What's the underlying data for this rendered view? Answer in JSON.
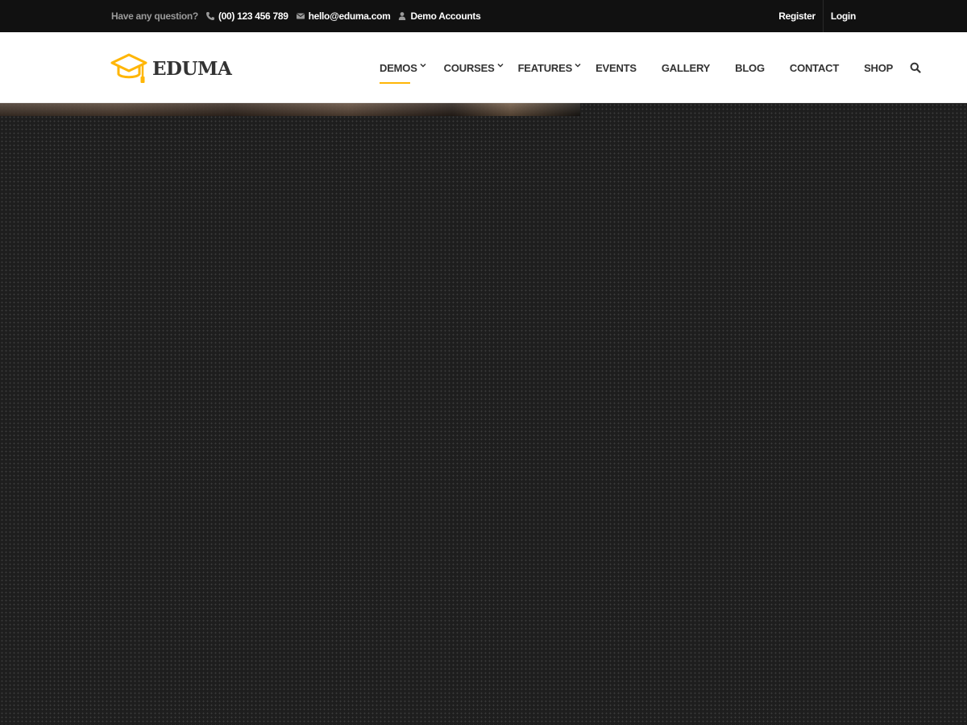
{
  "topbar": {
    "question": "Have any question?",
    "phone": "(00) 123 456 789",
    "email": "hello@eduma.com",
    "demo_accounts": "Demo Accounts",
    "register": "Register",
    "login": "Login"
  },
  "brand": {
    "name": "EDUMA",
    "accent": "#ffb606"
  },
  "nav": {
    "items": [
      {
        "label": "DEMOS",
        "dropdown": true,
        "active": true
      },
      {
        "label": "COURSES",
        "dropdown": true
      },
      {
        "label": "FEATURES",
        "dropdown": true
      },
      {
        "label": "EVENTS"
      },
      {
        "label": "GALLERY"
      },
      {
        "label": "BLOG"
      },
      {
        "label": "CONTACT"
      },
      {
        "label": "SHOP"
      }
    ]
  },
  "icons": {
    "phone": "phone-icon",
    "email": "envelope-icon",
    "user": "user-icon",
    "search": "search-icon",
    "logo": "graduation-cap-icon"
  }
}
